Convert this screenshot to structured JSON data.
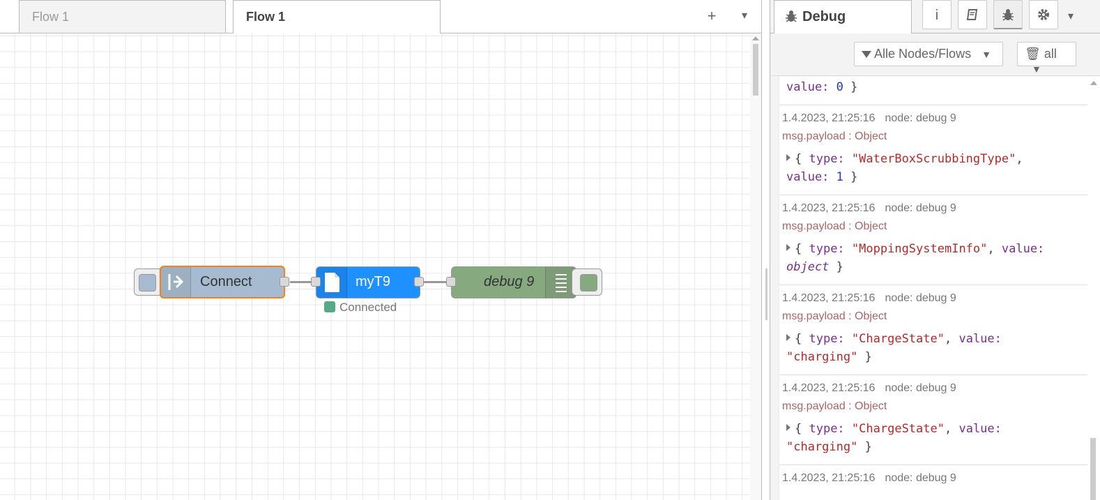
{
  "tabs": [
    {
      "label": "Flow 1"
    },
    {
      "label": "Flow 1"
    }
  ],
  "tab_actions": {
    "add": "+",
    "menu": "▾"
  },
  "nodes": {
    "connect": {
      "label": "Connect",
      "color": "#a6bbcf",
      "selected_border": "#ff7f0e"
    },
    "myt9": {
      "label": "myT9",
      "color": "#1e90ff",
      "status": "Connected",
      "status_color": "#5a8"
    },
    "debug": {
      "label": "debug 9",
      "color": "#87a980"
    }
  },
  "sidebar": {
    "active_tab": "Debug",
    "icons": [
      "info-icon",
      "book-icon",
      "bug-icon",
      "gear-icon"
    ],
    "filter_label": "Alle Nodes/Flows",
    "clear_label": "all",
    "partial_message": {
      "value": "0"
    },
    "messages": [
      {
        "time": "1.4.2023, 21:25:16",
        "node": "node: debug 9",
        "topic": "msg.payload : Object",
        "type": "\"WaterBoxScrubbingType\"",
        "value": "1",
        "value_kind": "number"
      },
      {
        "time": "1.4.2023, 21:25:16",
        "node": "node: debug 9",
        "topic": "msg.payload : Object",
        "type": "\"MoppingSystemInfo\"",
        "value": "object",
        "value_kind": "object"
      },
      {
        "time": "1.4.2023, 21:25:16",
        "node": "node: debug 9",
        "topic": "msg.payload : Object",
        "type": "\"ChargeState\"",
        "value": "\"charging\"",
        "value_kind": "string"
      },
      {
        "time": "1.4.2023, 21:25:16",
        "node": "node: debug 9",
        "topic": "msg.payload : Object",
        "type": "\"ChargeState\"",
        "value": "\"charging\"",
        "value_kind": "string"
      }
    ],
    "last_message": {
      "time": "1.4.2023, 21:25:16",
      "node": "node: debug 9"
    }
  }
}
